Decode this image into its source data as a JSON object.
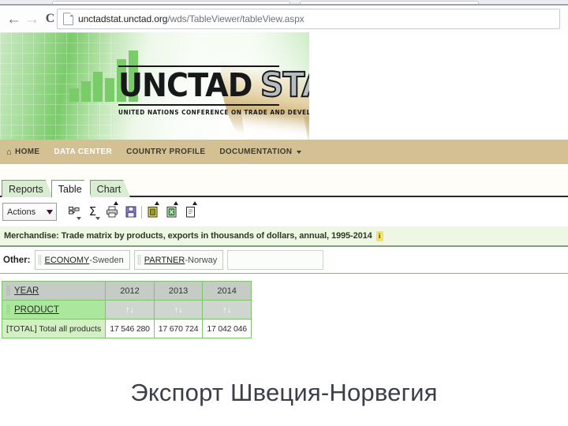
{
  "browser": {
    "back_icon": "back-arrow-icon",
    "forward_icon": "forward-arrow-icon",
    "reload_icon": "reload-icon",
    "home_icon": "home-icon",
    "url_host": "unctadstat.unctad.org",
    "url_path": "/wds/TableViewer/tableView.aspx"
  },
  "banner": {
    "logo_primary": "UNCTAD",
    "logo_secondary": "STAT",
    "tagline": "UNITED NATIONS CONFERENCE ON TRADE AND DEVELOPMENT",
    "bar_color": "#79cc69",
    "background_green": "#a7dd9b"
  },
  "site_nav": {
    "background": "#d3c193",
    "items": [
      {
        "label": "HOME",
        "icon": "home-icon",
        "active": false
      },
      {
        "label": "DATA CENTER",
        "active": true
      },
      {
        "label": "COUNTRY PROFILE",
        "active": false
      },
      {
        "label": "DOCUMENTATION",
        "active": false,
        "has_dropdown": true
      }
    ]
  },
  "app_tabs": [
    {
      "label": "Reports",
      "active": false
    },
    {
      "label": "Table",
      "active": true
    },
    {
      "label": "Chart",
      "active": false
    }
  ],
  "toolbar": {
    "actions_label": "Actions",
    "icons": [
      "layout-tree-icon",
      "sum-sigma-icon",
      "print-icon",
      "save-icon",
      "export-pdf-icon",
      "export-excel-icon",
      "export-csv-icon"
    ],
    "sigma_glyph": "Σ"
  },
  "dataset": {
    "title": "Merchandise: Trade matrix by products, exports in thousands of dollars, annual, 1995-2014",
    "info_badge": "i",
    "title_background": "#eef6e4"
  },
  "filters": {
    "label": "Other:",
    "chips": [
      {
        "name": "ECONOMY",
        "separator": " - ",
        "value": "Sweden"
      },
      {
        "name": "PARTNER",
        "separator": " - ",
        "value": "Norway"
      }
    ]
  },
  "table": {
    "row_header_year": "YEAR",
    "row_header_product": "PRODUCT",
    "columns": [
      "2012",
      "2013",
      "2014"
    ],
    "sort_glyph": "↑↓",
    "rows": [
      {
        "label": "[TOTAL] Total all products",
        "values": [
          "17 546 280",
          "17 670 724",
          "17 042 046"
        ]
      }
    ]
  },
  "caption": {
    "text": "Экспорт Швеция-Норвегия"
  }
}
